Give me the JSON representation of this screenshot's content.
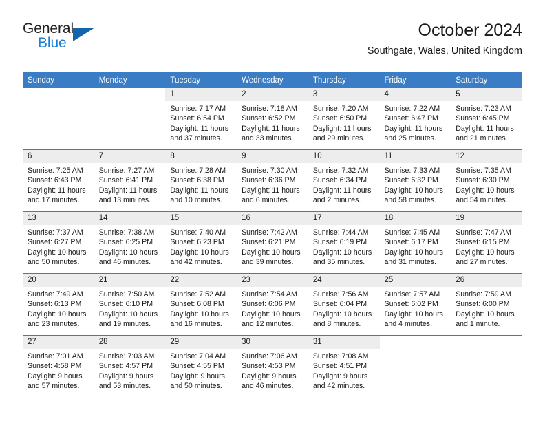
{
  "brand": {
    "name_top": "General",
    "name_bottom": "Blue",
    "triangle_color": "#1464ab",
    "blue_color": "#1a7fd4"
  },
  "header": {
    "title": "October 2024",
    "subtitle": "Southgate, Wales, United Kingdom"
  },
  "theme": {
    "header_bg": "#3b7dc4",
    "daynum_bg": "#ededed",
    "text": "#1a1a1a"
  },
  "weekday_headers": [
    "Sunday",
    "Monday",
    "Tuesday",
    "Wednesday",
    "Thursday",
    "Friday",
    "Saturday"
  ],
  "labels": {
    "sunrise": "Sunrise:",
    "sunset": "Sunset:",
    "daylight": "Daylight:"
  },
  "weeks": [
    [
      {
        "day": "",
        "blank": true
      },
      {
        "day": "",
        "blank": true
      },
      {
        "day": "1",
        "sunrise": "Sunrise: 7:17 AM",
        "sunset": "Sunset: 6:54 PM",
        "daylight_1": "Daylight: 11 hours",
        "daylight_2": "and 37 minutes."
      },
      {
        "day": "2",
        "sunrise": "Sunrise: 7:18 AM",
        "sunset": "Sunset: 6:52 PM",
        "daylight_1": "Daylight: 11 hours",
        "daylight_2": "and 33 minutes."
      },
      {
        "day": "3",
        "sunrise": "Sunrise: 7:20 AM",
        "sunset": "Sunset: 6:50 PM",
        "daylight_1": "Daylight: 11 hours",
        "daylight_2": "and 29 minutes."
      },
      {
        "day": "4",
        "sunrise": "Sunrise: 7:22 AM",
        "sunset": "Sunset: 6:47 PM",
        "daylight_1": "Daylight: 11 hours",
        "daylight_2": "and 25 minutes."
      },
      {
        "day": "5",
        "sunrise": "Sunrise: 7:23 AM",
        "sunset": "Sunset: 6:45 PM",
        "daylight_1": "Daylight: 11 hours",
        "daylight_2": "and 21 minutes."
      }
    ],
    [
      {
        "day": "6",
        "sunrise": "Sunrise: 7:25 AM",
        "sunset": "Sunset: 6:43 PM",
        "daylight_1": "Daylight: 11 hours",
        "daylight_2": "and 17 minutes."
      },
      {
        "day": "7",
        "sunrise": "Sunrise: 7:27 AM",
        "sunset": "Sunset: 6:41 PM",
        "daylight_1": "Daylight: 11 hours",
        "daylight_2": "and 13 minutes."
      },
      {
        "day": "8",
        "sunrise": "Sunrise: 7:28 AM",
        "sunset": "Sunset: 6:38 PM",
        "daylight_1": "Daylight: 11 hours",
        "daylight_2": "and 10 minutes."
      },
      {
        "day": "9",
        "sunrise": "Sunrise: 7:30 AM",
        "sunset": "Sunset: 6:36 PM",
        "daylight_1": "Daylight: 11 hours",
        "daylight_2": "and 6 minutes."
      },
      {
        "day": "10",
        "sunrise": "Sunrise: 7:32 AM",
        "sunset": "Sunset: 6:34 PM",
        "daylight_1": "Daylight: 11 hours",
        "daylight_2": "and 2 minutes."
      },
      {
        "day": "11",
        "sunrise": "Sunrise: 7:33 AM",
        "sunset": "Sunset: 6:32 PM",
        "daylight_1": "Daylight: 10 hours",
        "daylight_2": "and 58 minutes."
      },
      {
        "day": "12",
        "sunrise": "Sunrise: 7:35 AM",
        "sunset": "Sunset: 6:30 PM",
        "daylight_1": "Daylight: 10 hours",
        "daylight_2": "and 54 minutes."
      }
    ],
    [
      {
        "day": "13",
        "sunrise": "Sunrise: 7:37 AM",
        "sunset": "Sunset: 6:27 PM",
        "daylight_1": "Daylight: 10 hours",
        "daylight_2": "and 50 minutes."
      },
      {
        "day": "14",
        "sunrise": "Sunrise: 7:38 AM",
        "sunset": "Sunset: 6:25 PM",
        "daylight_1": "Daylight: 10 hours",
        "daylight_2": "and 46 minutes."
      },
      {
        "day": "15",
        "sunrise": "Sunrise: 7:40 AM",
        "sunset": "Sunset: 6:23 PM",
        "daylight_1": "Daylight: 10 hours",
        "daylight_2": "and 42 minutes."
      },
      {
        "day": "16",
        "sunrise": "Sunrise: 7:42 AM",
        "sunset": "Sunset: 6:21 PM",
        "daylight_1": "Daylight: 10 hours",
        "daylight_2": "and 39 minutes."
      },
      {
        "day": "17",
        "sunrise": "Sunrise: 7:44 AM",
        "sunset": "Sunset: 6:19 PM",
        "daylight_1": "Daylight: 10 hours",
        "daylight_2": "and 35 minutes."
      },
      {
        "day": "18",
        "sunrise": "Sunrise: 7:45 AM",
        "sunset": "Sunset: 6:17 PM",
        "daylight_1": "Daylight: 10 hours",
        "daylight_2": "and 31 minutes."
      },
      {
        "day": "19",
        "sunrise": "Sunrise: 7:47 AM",
        "sunset": "Sunset: 6:15 PM",
        "daylight_1": "Daylight: 10 hours",
        "daylight_2": "and 27 minutes."
      }
    ],
    [
      {
        "day": "20",
        "sunrise": "Sunrise: 7:49 AM",
        "sunset": "Sunset: 6:13 PM",
        "daylight_1": "Daylight: 10 hours",
        "daylight_2": "and 23 minutes."
      },
      {
        "day": "21",
        "sunrise": "Sunrise: 7:50 AM",
        "sunset": "Sunset: 6:10 PM",
        "daylight_1": "Daylight: 10 hours",
        "daylight_2": "and 19 minutes."
      },
      {
        "day": "22",
        "sunrise": "Sunrise: 7:52 AM",
        "sunset": "Sunset: 6:08 PM",
        "daylight_1": "Daylight: 10 hours",
        "daylight_2": "and 16 minutes."
      },
      {
        "day": "23",
        "sunrise": "Sunrise: 7:54 AM",
        "sunset": "Sunset: 6:06 PM",
        "daylight_1": "Daylight: 10 hours",
        "daylight_2": "and 12 minutes."
      },
      {
        "day": "24",
        "sunrise": "Sunrise: 7:56 AM",
        "sunset": "Sunset: 6:04 PM",
        "daylight_1": "Daylight: 10 hours",
        "daylight_2": "and 8 minutes."
      },
      {
        "day": "25",
        "sunrise": "Sunrise: 7:57 AM",
        "sunset": "Sunset: 6:02 PM",
        "daylight_1": "Daylight: 10 hours",
        "daylight_2": "and 4 minutes."
      },
      {
        "day": "26",
        "sunrise": "Sunrise: 7:59 AM",
        "sunset": "Sunset: 6:00 PM",
        "daylight_1": "Daylight: 10 hours",
        "daylight_2": "and 1 minute."
      }
    ],
    [
      {
        "day": "27",
        "sunrise": "Sunrise: 7:01 AM",
        "sunset": "Sunset: 4:58 PM",
        "daylight_1": "Daylight: 9 hours",
        "daylight_2": "and 57 minutes."
      },
      {
        "day": "28",
        "sunrise": "Sunrise: 7:03 AM",
        "sunset": "Sunset: 4:57 PM",
        "daylight_1": "Daylight: 9 hours",
        "daylight_2": "and 53 minutes."
      },
      {
        "day": "29",
        "sunrise": "Sunrise: 7:04 AM",
        "sunset": "Sunset: 4:55 PM",
        "daylight_1": "Daylight: 9 hours",
        "daylight_2": "and 50 minutes."
      },
      {
        "day": "30",
        "sunrise": "Sunrise: 7:06 AM",
        "sunset": "Sunset: 4:53 PM",
        "daylight_1": "Daylight: 9 hours",
        "daylight_2": "and 46 minutes."
      },
      {
        "day": "31",
        "sunrise": "Sunrise: 7:08 AM",
        "sunset": "Sunset: 4:51 PM",
        "daylight_1": "Daylight: 9 hours",
        "daylight_2": "and 42 minutes."
      },
      {
        "day": "",
        "blank": true
      },
      {
        "day": "",
        "blank": true
      }
    ]
  ]
}
